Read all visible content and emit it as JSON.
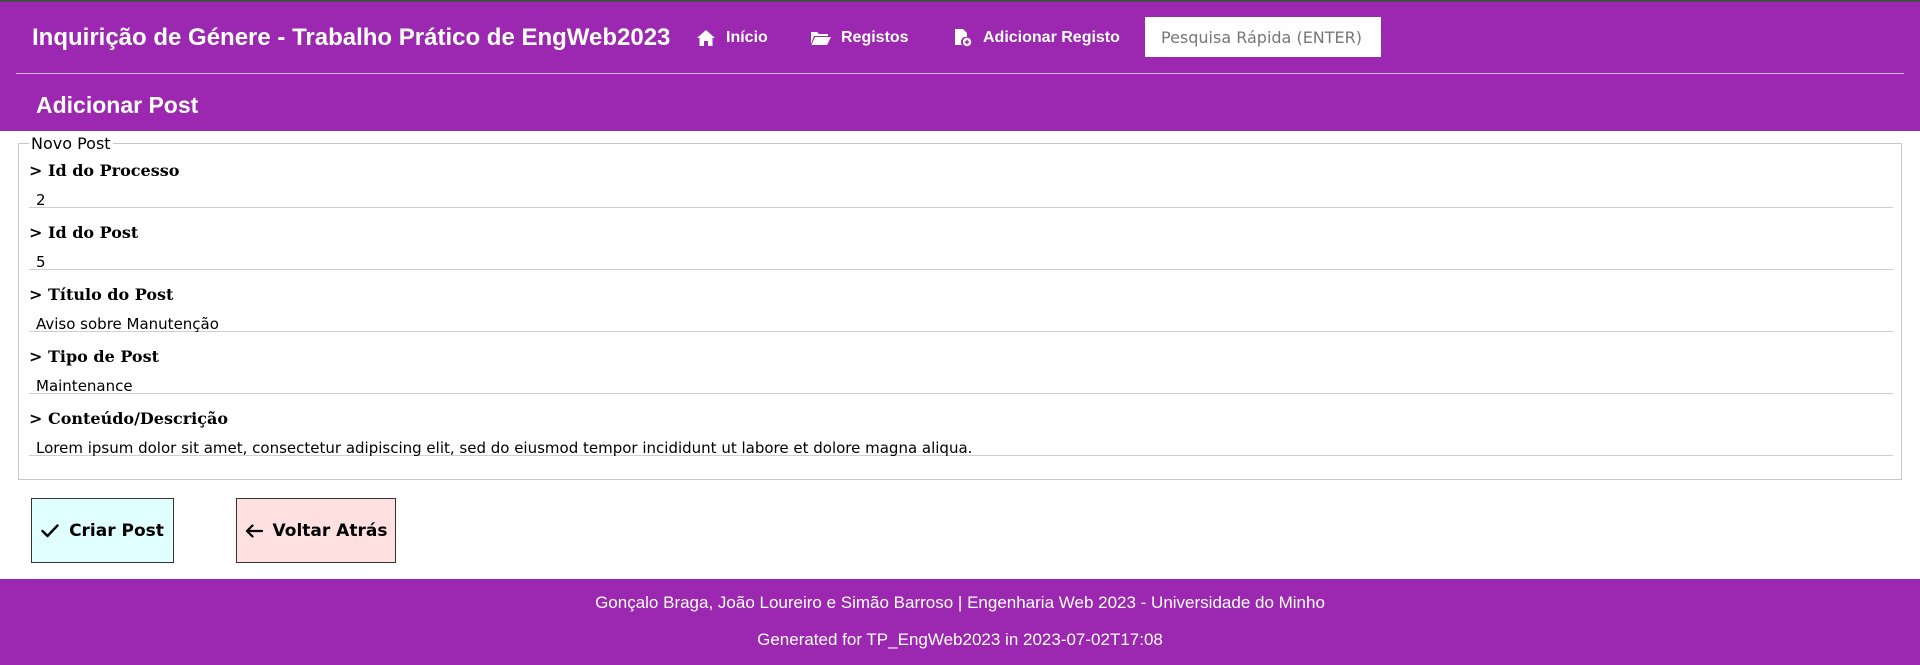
{
  "header": {
    "app_title": "Inquirição de Génere - Trabalho Prático de EngWeb2023",
    "nav": [
      {
        "label": "Início",
        "icon": "home-icon"
      },
      {
        "label": "Registos",
        "icon": "folder-open-icon"
      },
      {
        "label": "Adicionar Registo",
        "icon": "file-add-icon"
      }
    ],
    "search_placeholder": "Pesquisa Rápida (ENTER)",
    "page_title": "Adicionar Post"
  },
  "form": {
    "legend": "Novo Post",
    "fields": [
      {
        "label": "> Id do Processo",
        "value": "2"
      },
      {
        "label": "> Id do Post",
        "value": "5"
      },
      {
        "label": "> Título do Post",
        "value": "Aviso sobre Manutenção"
      },
      {
        "label": "> Tipo de Post",
        "value": "Maintenance"
      },
      {
        "label": "> Conteúdo/Descrição",
        "value": "Lorem ipsum dolor sit amet, consectetur adipiscing elit, sed do eiusmod tempor incididunt ut labore et dolore magna aliqua."
      }
    ]
  },
  "buttons": {
    "create_label": "Criar Post",
    "back_label": "Voltar Atrás",
    "create_color": "#e0ffff",
    "back_color": "#ffe0e0"
  },
  "footer": {
    "line1": "Gonçalo Braga, João Loureiro e Simão Barroso | Engenharia Web 2023 - Universidade do Minho",
    "line2": "Generated for TP_EngWeb2023 in 2023-07-02T17:08"
  },
  "colors": {
    "brand": "#9c27b0"
  }
}
